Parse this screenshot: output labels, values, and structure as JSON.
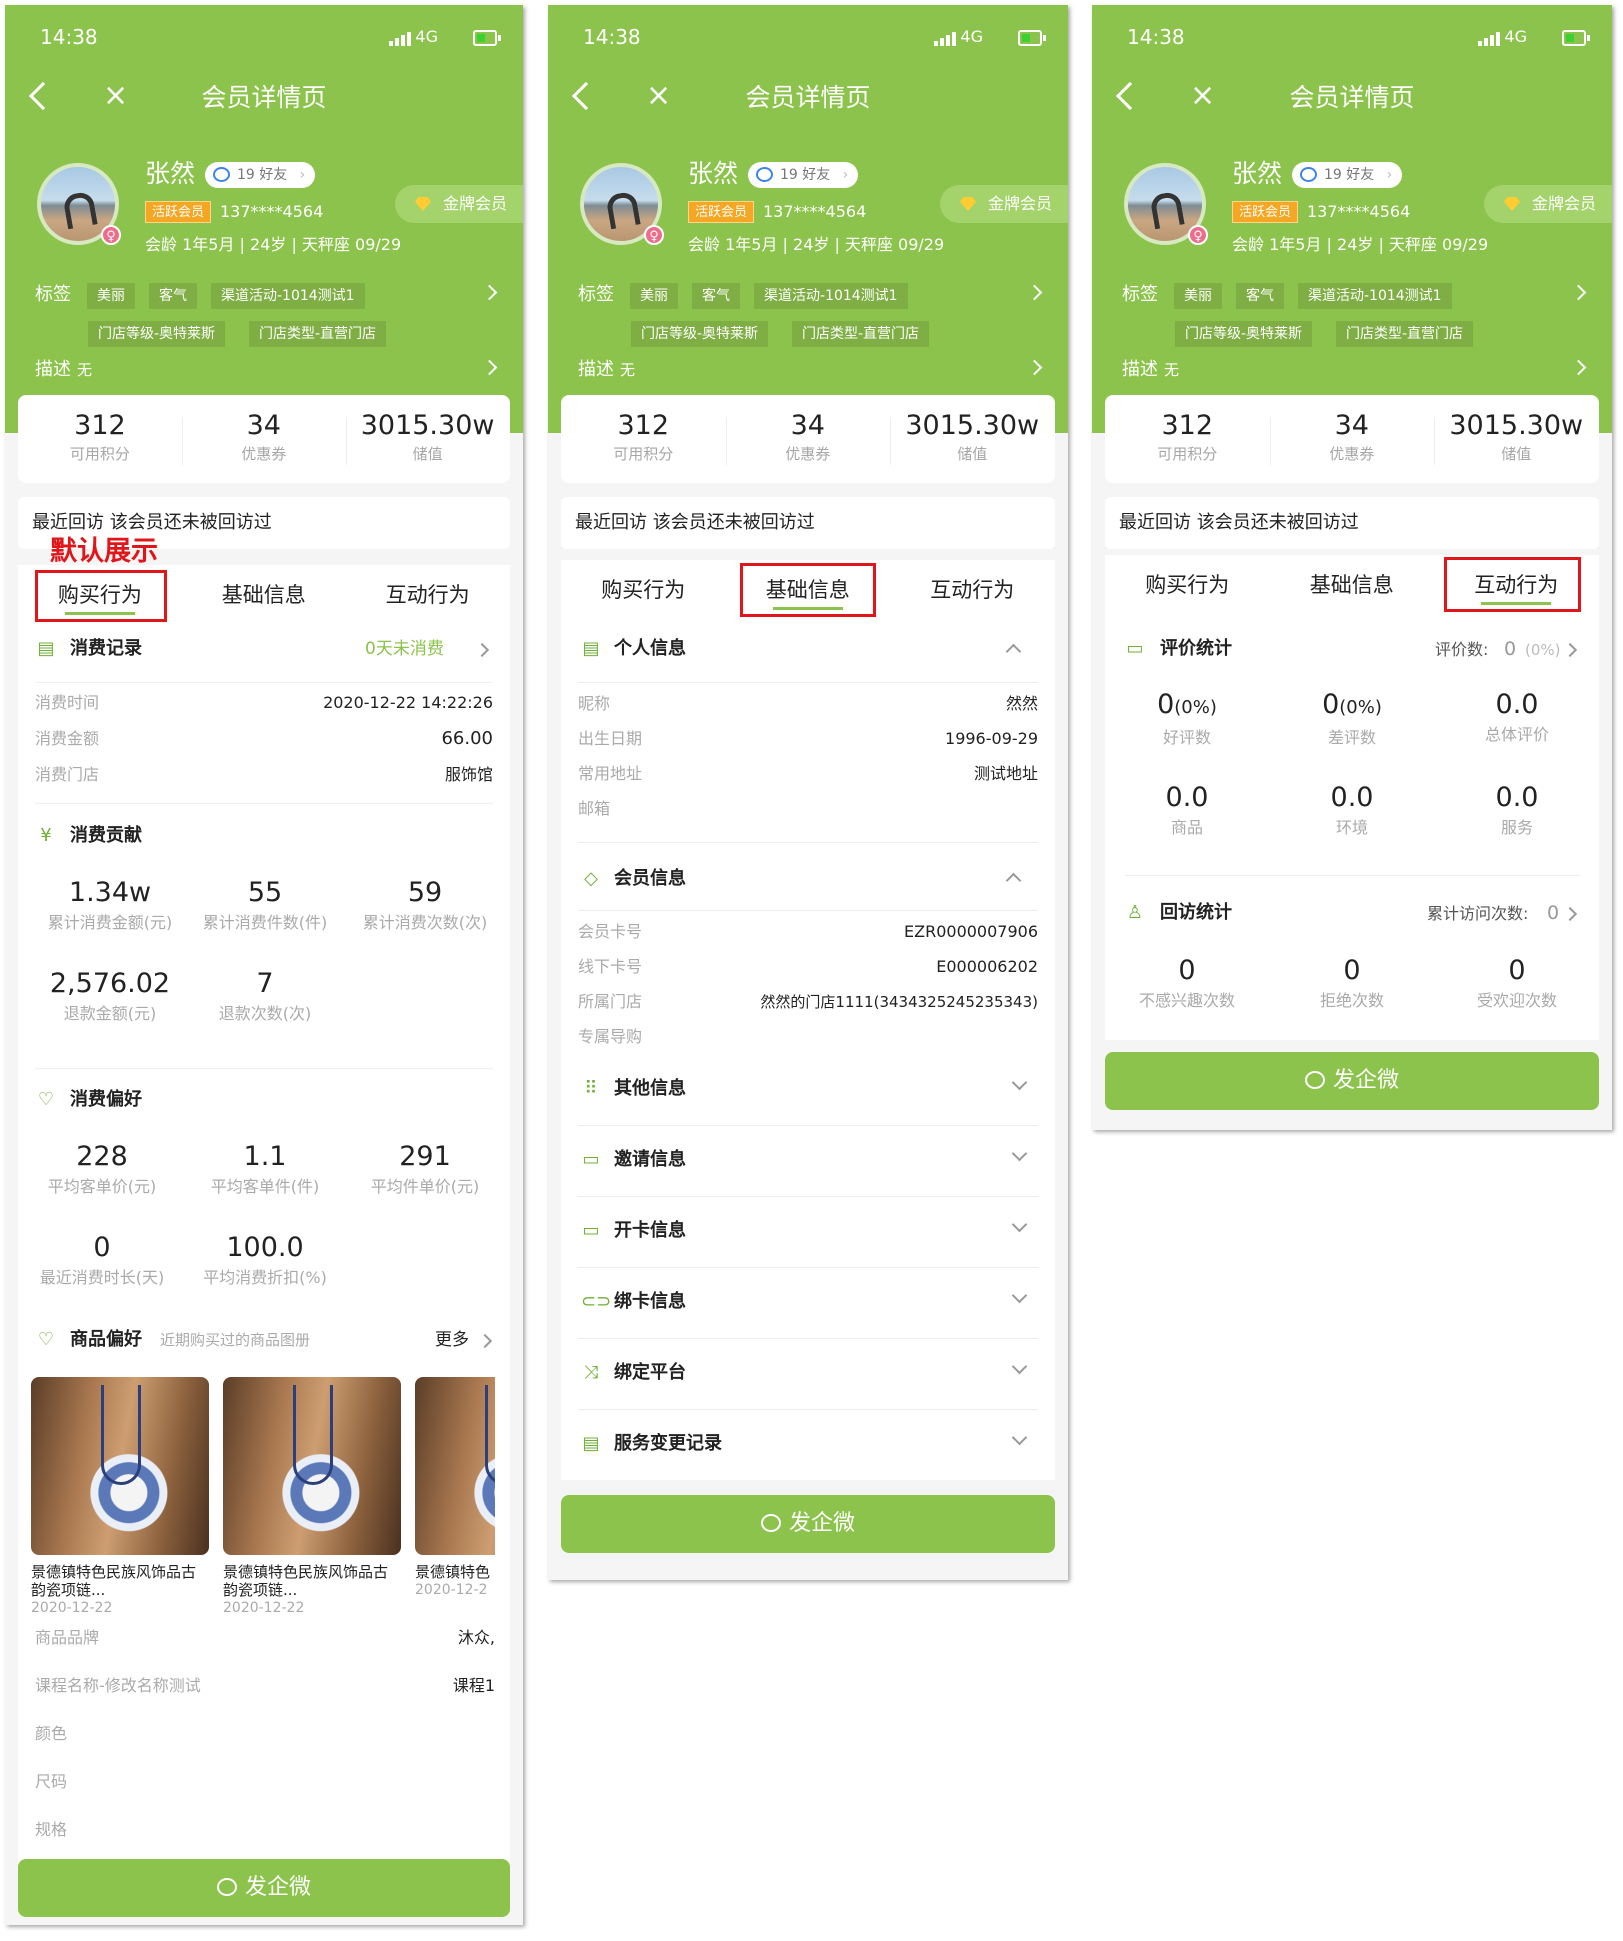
{
  "status": {
    "time": "14:38",
    "network": "4G"
  },
  "nav": {
    "title": "会员详情页",
    "close": "×"
  },
  "member": {
    "name": "张然",
    "friends": "19 好友",
    "level_badge": "活跃会员",
    "phone": "137****4564",
    "meta": "会龄 1年5月 | 24岁 | 天秤座 09/29",
    "gold": "金牌会员",
    "gender": "♀"
  },
  "tags": {
    "label": "标签",
    "items": [
      "美丽",
      "客气",
      "渠道活动-1014测试1",
      "门店等级-奥特莱斯",
      "门店类型-直营门店"
    ]
  },
  "desc": {
    "label": "描述",
    "value": "无"
  },
  "stats": [
    {
      "value": "312",
      "label": "可用积分"
    },
    {
      "value": "34",
      "label": "优惠券"
    },
    {
      "value": "3015.30w",
      "label": "储值"
    }
  ],
  "recent_visit": "最近回访 该会员还未被回访过",
  "tabs": [
    "购买行为",
    "基础信息",
    "互动行为"
  ],
  "annotation": "默认展示",
  "purchase": {
    "records_title": "消费记录",
    "no_consume": "0天未消费",
    "records": [
      {
        "k": "消费时间",
        "v": "2020-12-22 14:22:26"
      },
      {
        "k": "消费金额",
        "v": "66.00"
      },
      {
        "k": "消费门店",
        "v": "服饰馆"
      }
    ],
    "contrib_title": "消费贡献",
    "contrib": [
      {
        "value": "1.34w",
        "label": "累计消费金额(元)"
      },
      {
        "value": "55",
        "label": "累计消费件数(件)"
      },
      {
        "value": "59",
        "label": "累计消费次数(次)"
      },
      {
        "value": "2,576.02",
        "label": "退款金额(元)"
      },
      {
        "value": "7",
        "label": "退款次数(次)"
      }
    ],
    "pref_title": "消费偏好",
    "pref": [
      {
        "value": "228",
        "label": "平均客单价(元)"
      },
      {
        "value": "1.1",
        "label": "平均客单件(件)"
      },
      {
        "value": "291",
        "label": "平均件单价(元)"
      },
      {
        "value": "0",
        "label": "最近消费时长(天)"
      },
      {
        "value": "100.0",
        "label": "平均消费折扣(%)"
      }
    ],
    "goods_title": "商品偏好",
    "goods_sub": "近期购买过的商品图册",
    "more": "更多",
    "products": [
      {
        "name": "景德镇特色民族风饰品古韵瓷项链...",
        "date": "2020-12-22"
      },
      {
        "name": "景德镇特色民族风饰品古韵瓷项链...",
        "date": "2020-12-22"
      },
      {
        "name": "景德镇特色",
        "date": "2020-12-2"
      }
    ],
    "attrs": [
      {
        "k": "商品品牌",
        "v": "沐众,"
      },
      {
        "k": "课程名称-修改名称测试",
        "v": "课程1"
      },
      {
        "k": "颜色",
        "v": ""
      },
      {
        "k": "尺码",
        "v": ""
      },
      {
        "k": "规格",
        "v": ""
      }
    ]
  },
  "basic": {
    "personal_title": "个人信息",
    "personal": [
      {
        "k": "昵称",
        "v": "然然"
      },
      {
        "k": "出生日期",
        "v": "1996-09-29"
      },
      {
        "k": "常用地址",
        "v": "测试地址"
      },
      {
        "k": "邮箱",
        "v": ""
      }
    ],
    "member_title": "会员信息",
    "member": [
      {
        "k": "会员卡号",
        "v": "EZR0000007906"
      },
      {
        "k": "线下卡号",
        "v": "E000006202"
      },
      {
        "k": "所属门店",
        "v": "然然的门店1111(3434325245235343)"
      },
      {
        "k": "专属导购",
        "v": ""
      }
    ],
    "sections": [
      "其他信息",
      "邀请信息",
      "开卡信息",
      "绑卡信息",
      "绑定平台",
      "服务变更记录"
    ]
  },
  "interact": {
    "eval_title": "评价统计",
    "eval_count_label": "评价数:",
    "eval_count": "0",
    "eval_pct": "(0%)",
    "eval": [
      {
        "value": "0",
        "suffix": "(0%)",
        "label": "好评数"
      },
      {
        "value": "0",
        "suffix": "(0%)",
        "label": "差评数"
      },
      {
        "value": "0.0",
        "suffix": "",
        "label": "总体评价"
      },
      {
        "value": "0.0",
        "suffix": "",
        "label": "商品"
      },
      {
        "value": "0.0",
        "suffix": "",
        "label": "环境"
      },
      {
        "value": "0.0",
        "suffix": "",
        "label": "服务"
      }
    ],
    "visit_title": "回访统计",
    "visit_count_label": "累计访问次数:",
    "visit_count": "0",
    "visit": [
      {
        "value": "0",
        "label": "不感兴趣次数"
      },
      {
        "value": "0",
        "label": "拒绝次数"
      },
      {
        "value": "0",
        "label": "受欢迎次数"
      }
    ]
  },
  "button": "发企微",
  "colors": {
    "brand": "#8cc34c",
    "highlight": "#e0161a",
    "badge": "#f5a623"
  }
}
